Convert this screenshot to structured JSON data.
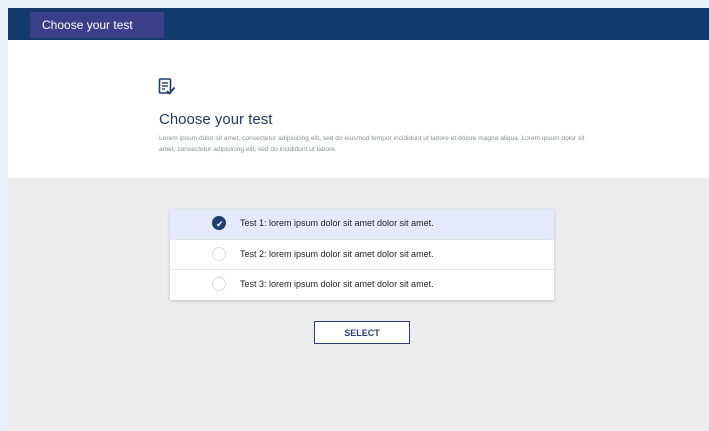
{
  "topbar": {
    "tab_label": "Choose your test"
  },
  "header": {
    "title": "Choose your test",
    "description": "Lorem ipsum dolor sit amet, consectetur adipisicing elit, sed do eiusmod tempor incididunt ut labore et dolore magna aliqua. Lorem ipsum dolor sit amet, consectetur adipisicing elit, sed do incididunt ut labore."
  },
  "tests": [
    {
      "label": "Test 1: lorem ipsum dolor sit amet dolor sit amet.",
      "selected": true
    },
    {
      "label": "Test 2: lorem ipsum dolor sit amet dolor sit amet.",
      "selected": false
    },
    {
      "label": "Test 3: lorem ipsum dolor sit amet dolor sit amet.",
      "selected": false
    }
  ],
  "actions": {
    "select_label": "SELECT"
  },
  "icons": {
    "header_icon": "document-check-icon",
    "selected_mark": "checkmark-icon"
  },
  "colors": {
    "navy": "#123a6b",
    "tab": "#3b3f8a",
    "selected_row": "#e5e9fb",
    "radio_checked": "#1f3f72",
    "button_border": "#2e3f7a"
  }
}
